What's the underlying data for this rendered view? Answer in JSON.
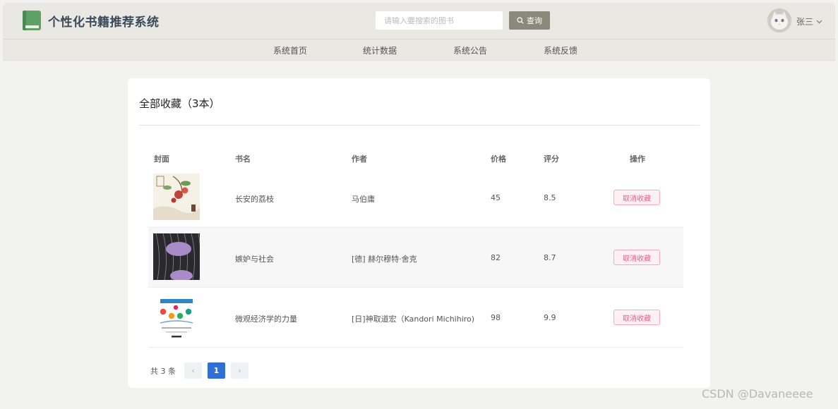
{
  "header": {
    "site_title": "个性化书籍推荐系统",
    "search_placeholder": "请输入要搜索的图书",
    "search_label": "查询",
    "username": "张三"
  },
  "nav": {
    "items": [
      {
        "label": "系统首页"
      },
      {
        "label": "统计数据"
      },
      {
        "label": "系统公告"
      },
      {
        "label": "系统反馈"
      }
    ]
  },
  "favorites": {
    "title": "全部收藏（3本）",
    "columns": {
      "cover": "封面",
      "name": "书名",
      "author": "作者",
      "price": "价格",
      "rating": "评分",
      "action": "操作"
    },
    "rows": [
      {
        "name": "长安的荔枝",
        "author": "马伯庸",
        "price": "45",
        "rating": "8.5",
        "action": "取消收藏",
        "cover_icon": "lychee-book-cover"
      },
      {
        "name": "嫉妒与社会",
        "author": "[德] 赫尔穆特·舍克",
        "price": "82",
        "rating": "8.7",
        "action": "取消收藏",
        "cover_icon": "purple-striped-book-cover"
      },
      {
        "name": "微观经济学的力量",
        "author": "[日]神取道宏（Kandori Michihiro)",
        "price": "98",
        "rating": "9.9",
        "action": "取消收藏",
        "cover_icon": "economics-diagram-book-cover"
      }
    ]
  },
  "pagination": {
    "total": "共 3 条",
    "prev": "‹",
    "current": "1",
    "next": "›"
  },
  "watermark": "CSDN @Davaneeee",
  "colors": {
    "header_bg": "#e9e8e2",
    "search_button": "#8a8a7c",
    "cancel_text": "#ef5d87",
    "active_page": "#2f6fd6"
  }
}
